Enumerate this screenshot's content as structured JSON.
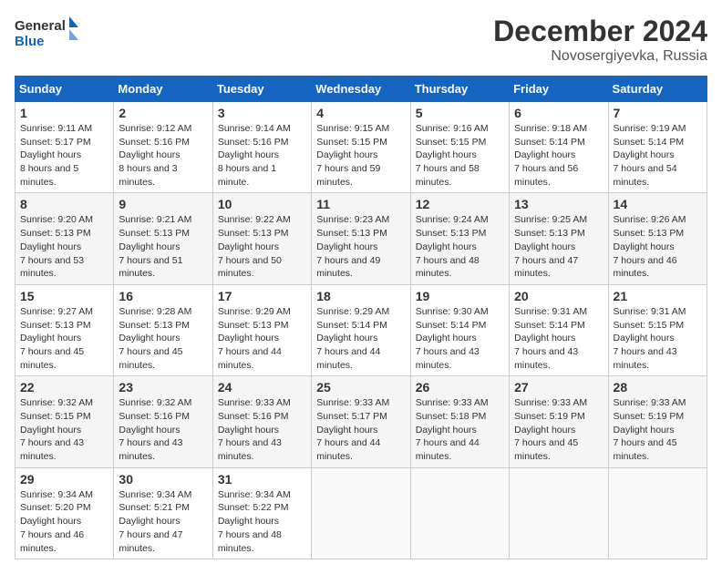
{
  "logo": {
    "line1": "General",
    "line2": "Blue"
  },
  "title": "December 2024",
  "subtitle": "Novosergiyevka, Russia",
  "days_of_week": [
    "Sunday",
    "Monday",
    "Tuesday",
    "Wednesday",
    "Thursday",
    "Friday",
    "Saturday"
  ],
  "weeks": [
    [
      {
        "day": "1",
        "rise": "9:11 AM",
        "set": "5:17 PM",
        "daylight": "8 hours and 5 minutes."
      },
      {
        "day": "2",
        "rise": "9:12 AM",
        "set": "5:16 PM",
        "daylight": "8 hours and 3 minutes."
      },
      {
        "day": "3",
        "rise": "9:14 AM",
        "set": "5:16 PM",
        "daylight": "8 hours and 1 minute."
      },
      {
        "day": "4",
        "rise": "9:15 AM",
        "set": "5:15 PM",
        "daylight": "7 hours and 59 minutes."
      },
      {
        "day": "5",
        "rise": "9:16 AM",
        "set": "5:15 PM",
        "daylight": "7 hours and 58 minutes."
      },
      {
        "day": "6",
        "rise": "9:18 AM",
        "set": "5:14 PM",
        "daylight": "7 hours and 56 minutes."
      },
      {
        "day": "7",
        "rise": "9:19 AM",
        "set": "5:14 PM",
        "daylight": "7 hours and 54 minutes."
      }
    ],
    [
      {
        "day": "8",
        "rise": "9:20 AM",
        "set": "5:13 PM",
        "daylight": "7 hours and 53 minutes."
      },
      {
        "day": "9",
        "rise": "9:21 AM",
        "set": "5:13 PM",
        "daylight": "7 hours and 51 minutes."
      },
      {
        "day": "10",
        "rise": "9:22 AM",
        "set": "5:13 PM",
        "daylight": "7 hours and 50 minutes."
      },
      {
        "day": "11",
        "rise": "9:23 AM",
        "set": "5:13 PM",
        "daylight": "7 hours and 49 minutes."
      },
      {
        "day": "12",
        "rise": "9:24 AM",
        "set": "5:13 PM",
        "daylight": "7 hours and 48 minutes."
      },
      {
        "day": "13",
        "rise": "9:25 AM",
        "set": "5:13 PM",
        "daylight": "7 hours and 47 minutes."
      },
      {
        "day": "14",
        "rise": "9:26 AM",
        "set": "5:13 PM",
        "daylight": "7 hours and 46 minutes."
      }
    ],
    [
      {
        "day": "15",
        "rise": "9:27 AM",
        "set": "5:13 PM",
        "daylight": "7 hours and 45 minutes."
      },
      {
        "day": "16",
        "rise": "9:28 AM",
        "set": "5:13 PM",
        "daylight": "7 hours and 45 minutes."
      },
      {
        "day": "17",
        "rise": "9:29 AM",
        "set": "5:13 PM",
        "daylight": "7 hours and 44 minutes."
      },
      {
        "day": "18",
        "rise": "9:29 AM",
        "set": "5:14 PM",
        "daylight": "7 hours and 44 minutes."
      },
      {
        "day": "19",
        "rise": "9:30 AM",
        "set": "5:14 PM",
        "daylight": "7 hours and 43 minutes."
      },
      {
        "day": "20",
        "rise": "9:31 AM",
        "set": "5:14 PM",
        "daylight": "7 hours and 43 minutes."
      },
      {
        "day": "21",
        "rise": "9:31 AM",
        "set": "5:15 PM",
        "daylight": "7 hours and 43 minutes."
      }
    ],
    [
      {
        "day": "22",
        "rise": "9:32 AM",
        "set": "5:15 PM",
        "daylight": "7 hours and 43 minutes."
      },
      {
        "day": "23",
        "rise": "9:32 AM",
        "set": "5:16 PM",
        "daylight": "7 hours and 43 minutes."
      },
      {
        "day": "24",
        "rise": "9:33 AM",
        "set": "5:16 PM",
        "daylight": "7 hours and 43 minutes."
      },
      {
        "day": "25",
        "rise": "9:33 AM",
        "set": "5:17 PM",
        "daylight": "7 hours and 44 minutes."
      },
      {
        "day": "26",
        "rise": "9:33 AM",
        "set": "5:18 PM",
        "daylight": "7 hours and 44 minutes."
      },
      {
        "day": "27",
        "rise": "9:33 AM",
        "set": "5:19 PM",
        "daylight": "7 hours and 45 minutes."
      },
      {
        "day": "28",
        "rise": "9:33 AM",
        "set": "5:19 PM",
        "daylight": "7 hours and 45 minutes."
      }
    ],
    [
      {
        "day": "29",
        "rise": "9:34 AM",
        "set": "5:20 PM",
        "daylight": "7 hours and 46 minutes."
      },
      {
        "day": "30",
        "rise": "9:34 AM",
        "set": "5:21 PM",
        "daylight": "7 hours and 47 minutes."
      },
      {
        "day": "31",
        "rise": "9:34 AM",
        "set": "5:22 PM",
        "daylight": "7 hours and 48 minutes."
      },
      null,
      null,
      null,
      null
    ]
  ],
  "labels": {
    "sunrise": "Sunrise:",
    "sunset": "Sunset:",
    "daylight": "Daylight hours"
  }
}
